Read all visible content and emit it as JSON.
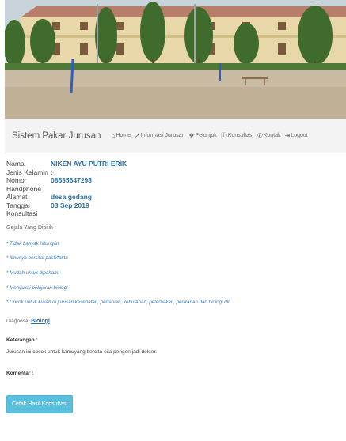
{
  "navbar": {
    "brand": "Sistem Pakar Jurusan",
    "items": [
      {
        "label": "Home",
        "icon": "home-icon"
      },
      {
        "label": "Informasi Jurusan",
        "icon": "wrench-icon"
      },
      {
        "label": "Petunjuk",
        "icon": "info-icon"
      },
      {
        "label": "Konsultasi",
        "icon": "question-icon"
      },
      {
        "label": "Kontak",
        "icon": "phone-icon"
      },
      {
        "label": "Logout",
        "icon": "logout-icon"
      }
    ]
  },
  "profile": {
    "nama_label": "Nama",
    "nama": "NIKEN AYU PUTRI ERIK",
    "jk_label": "Jenis Kelamin",
    "jk": ":",
    "hp_label": "Nomor Handphone",
    "hp": "08535647298",
    "alamat_label": "Alamat",
    "alamat": "desa gedang",
    "tanggal_label": "Tanggal Konsultasi",
    "tanggal": "03 Sep 2019"
  },
  "gejala": {
    "title": "Gejala Yang Dipilih :",
    "items": [
      "* Tidak banyak hitungan",
      "* Ilmunya bersifat pasti/fakta",
      "* Mudah untuk dipahami",
      "* Menyukai pelajaran biologi",
      "* Cocok untuk kuliah di jurusan kesehatan, pertanian, kehutanan, peternakan, perikanan dan biologi dll."
    ]
  },
  "diagnosa": {
    "label": "Diagnosa:",
    "value": "Biologi"
  },
  "keterangan": {
    "title": "Keterangan :",
    "text": "Jurusan ini cocok untuk kamuyang bercita-cita pengen jadi dokter."
  },
  "komentar": {
    "title": "Komentar :"
  },
  "button": {
    "cetak": "Cetak Hasil Konsultasi"
  },
  "colors": {
    "accent": "#5bc0de",
    "link": "#2a6fa8"
  }
}
